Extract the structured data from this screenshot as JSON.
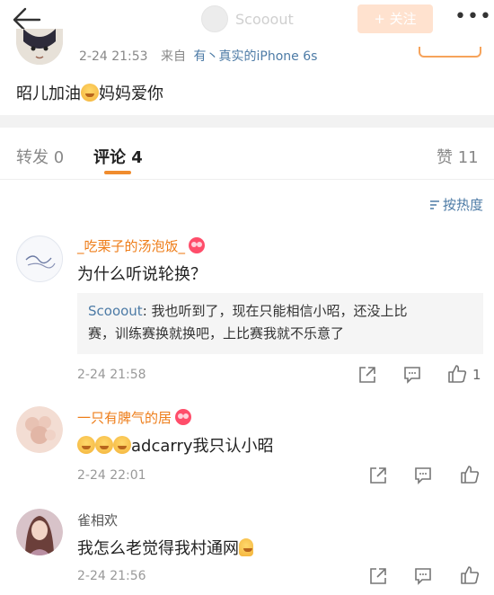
{
  "header": {
    "username": "Scooout",
    "follow_label": "+ 关注",
    "more_label": "•••"
  },
  "post": {
    "time": "2-24 21:53",
    "source_prefix": "来自",
    "source_link": "有丶真实的iPhone 6s",
    "text_before_emoji": "昭儿加油",
    "emoji": "emoji-face-icon",
    "text_after_emoji": "妈妈爱你"
  },
  "tabs": {
    "repost": "转发 0",
    "comment": "评论 4",
    "like": "赞 11",
    "active": "comment"
  },
  "sort": {
    "label": "按热度"
  },
  "comments": [
    {
      "name": "_吃栗子的汤泡饭_",
      "name_color": "#ee7d19",
      "has_badge": true,
      "text": "为什么听说轮换？",
      "reply": {
        "author": "Scooout",
        "line1": "我也听到了，现在只能相信小昭，还没上比",
        "line2": "赛，训练赛换就换吧，上比赛我就不乐意了"
      },
      "time": "2-24 21:58",
      "like_count": "1"
    },
    {
      "name": "一只有脾气的居",
      "name_color": "#ee7d19",
      "has_badge": true,
      "text_after_emojis": "adcarry我只认小昭",
      "time": "2-24 22:01"
    },
    {
      "name": "雀相欢",
      "name_color": "#555555",
      "has_badge": false,
      "text": "我怎么老觉得我村通网",
      "time": "2-24 21:56"
    }
  ],
  "colors": {
    "accent": "#f08c2e",
    "link": "#4d7ba6",
    "orange_name": "#ee7d19"
  }
}
